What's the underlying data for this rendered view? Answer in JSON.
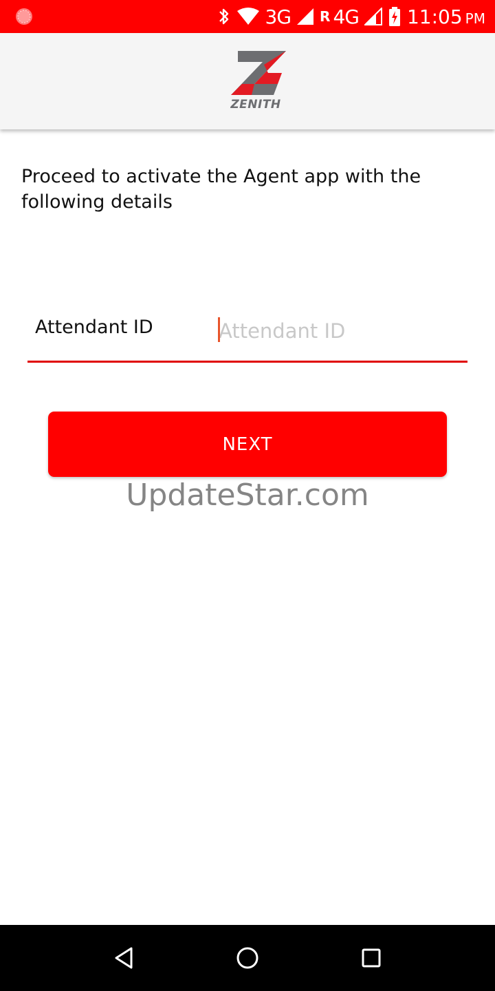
{
  "status_bar": {
    "network_1": "3G",
    "roaming": "R",
    "network_2": "4G",
    "time": "11:05",
    "ampm": "PM",
    "icons": [
      "record-icon",
      "bluetooth-icon",
      "wifi-icon",
      "signal-icon",
      "battery-charging-icon"
    ]
  },
  "app_bar": {
    "logo_text": "ZENITH"
  },
  "main": {
    "intro_text": "Proceed to activate the Agent app with the following details",
    "attendant_label": "Attendant ID",
    "attendant_placeholder": "Attendant ID",
    "attendant_value": "",
    "next_label": "NEXT"
  },
  "watermark": "UpdateStar.com",
  "nav_bar": {
    "icons": [
      "back-icon",
      "home-icon",
      "recents-icon"
    ]
  },
  "colors": {
    "brand_red": "#ff0000",
    "underline_red": "#e00000",
    "caret": "#e8552b",
    "logo_grey": "#6d6e71"
  }
}
